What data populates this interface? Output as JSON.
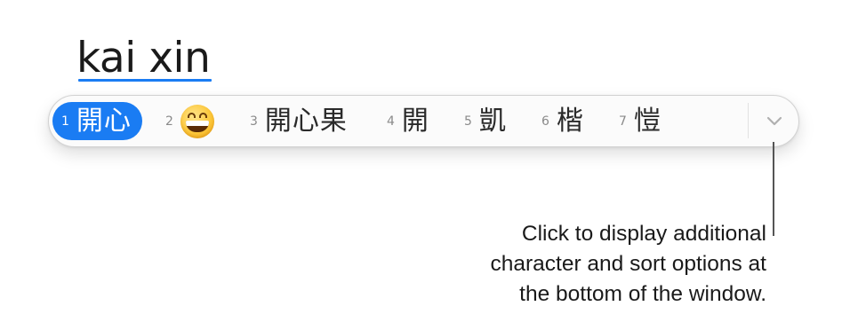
{
  "input": {
    "composition": "kai xin",
    "underline_color": "#1a7cf3"
  },
  "candidates": [
    {
      "number": "1",
      "text": "開心",
      "selected": true
    },
    {
      "number": "2",
      "emoji": "grinning-face-icon",
      "selected": false
    },
    {
      "number": "3",
      "text": "開心果",
      "selected": false
    },
    {
      "number": "4",
      "text": "開",
      "selected": false
    },
    {
      "number": "5",
      "text": "凱",
      "selected": false
    },
    {
      "number": "6",
      "text": "楷",
      "selected": false
    },
    {
      "number": "7",
      "text": "愷",
      "selected": false
    }
  ],
  "expand_button": {
    "icon": "chevron-down-icon"
  },
  "accent_color": "#1a7cf3",
  "callout": {
    "lines": [
      "Click to display additional",
      "character and sort options at",
      "the bottom of the window."
    ]
  }
}
